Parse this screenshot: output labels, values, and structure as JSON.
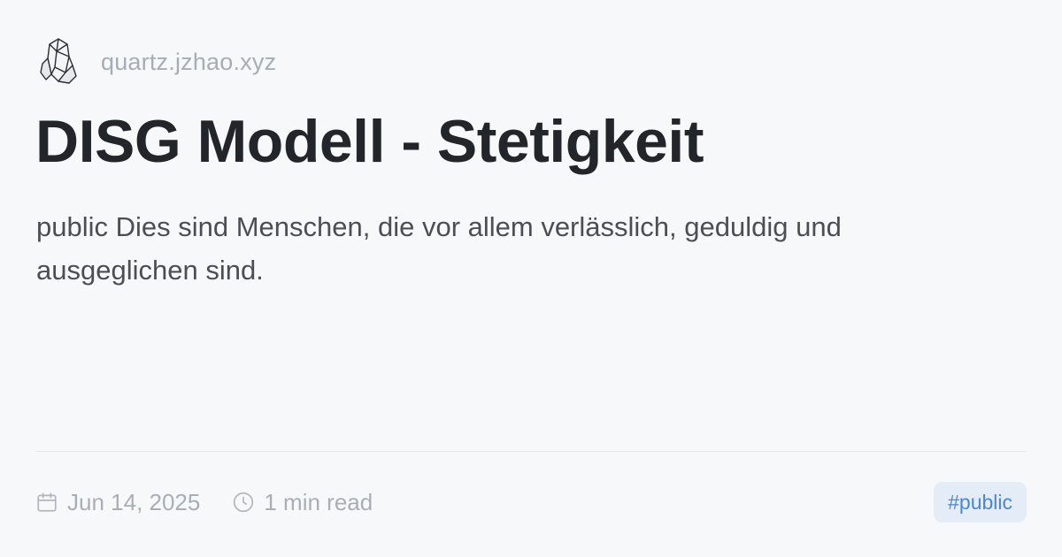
{
  "header": {
    "logo_icon": "crystal-logo-icon",
    "site": "quartz.jzhao.xyz"
  },
  "title": "DISG Modell - Stetigkeit",
  "description": "public Dies sind Menschen, die vor allem verlässlich, geduldig und ausgeglichen sind.",
  "footer": {
    "date_icon": "calendar-icon",
    "date": "Jun 14, 2025",
    "read_icon": "clock-icon",
    "read_time": "1 min read",
    "tag": "#public"
  },
  "colors": {
    "background": "#f7f8fa",
    "title": "#22262b",
    "muted": "#a9aeb6",
    "tag_bg": "#e4ecf7",
    "tag_text": "#4d86d1"
  }
}
